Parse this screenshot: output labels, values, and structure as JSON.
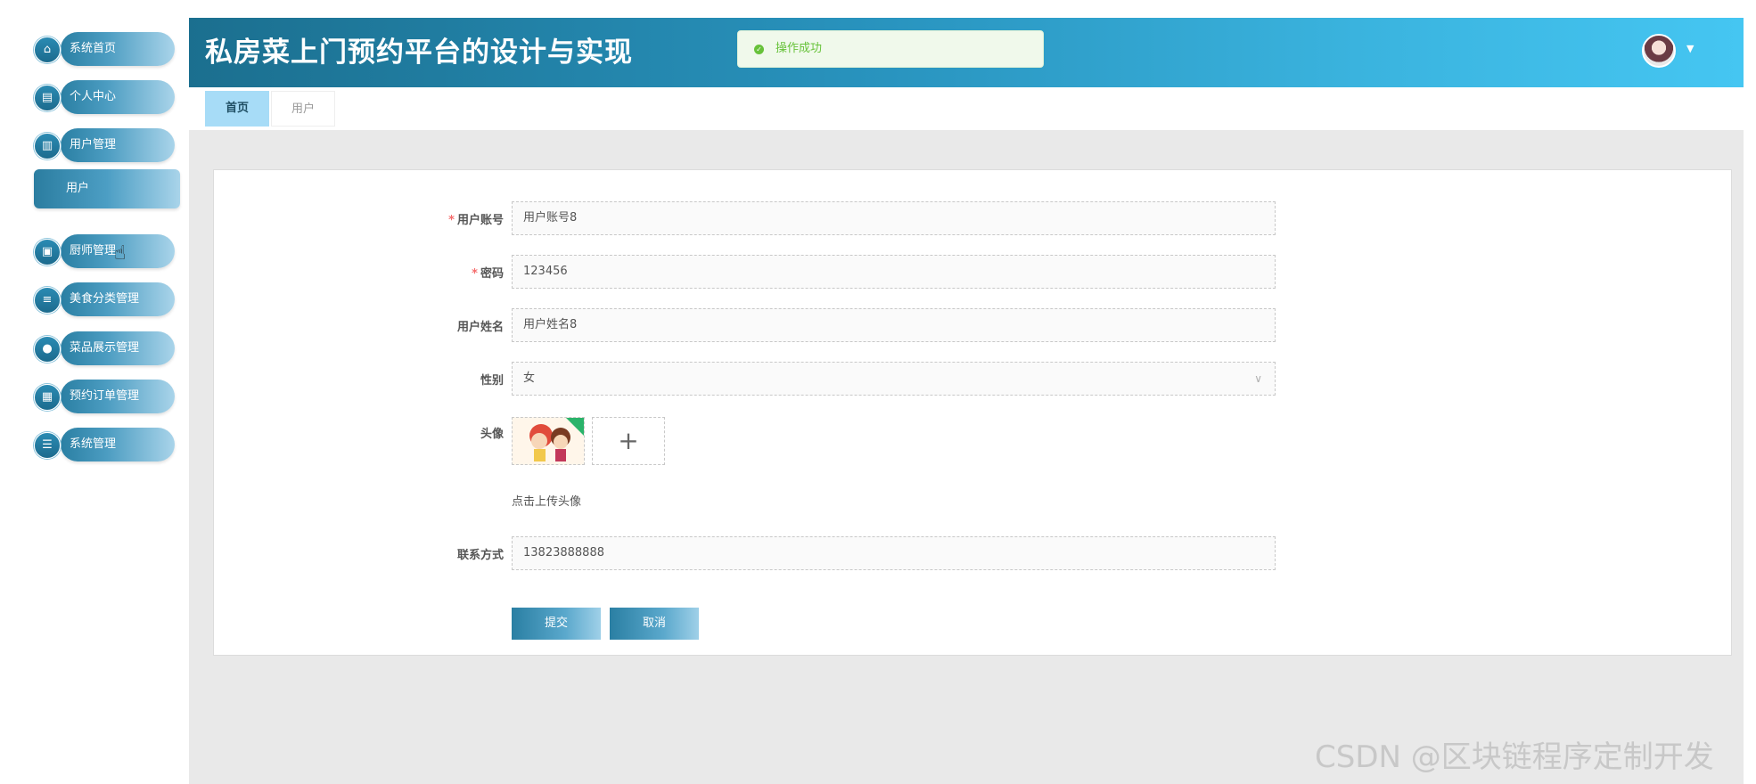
{
  "app": {
    "title": "私房菜上门预约平台的设计与实现"
  },
  "toast": {
    "text": "操作成功",
    "icon": "check-circle-icon",
    "color": "#67c23a"
  },
  "sidebar": {
    "items": [
      {
        "label": "系统首页",
        "icon": "home-icon",
        "glyph": "⌂"
      },
      {
        "label": "个人中心",
        "icon": "id-card-icon",
        "glyph": "▤"
      },
      {
        "label": "用户管理",
        "icon": "bar-chart-icon",
        "glyph": "▥"
      },
      {
        "label": "厨师管理",
        "icon": "clipboard-icon",
        "glyph": "▣"
      },
      {
        "label": "美食分类管理",
        "icon": "list-icon",
        "glyph": "≡"
      },
      {
        "label": "菜品展示管理",
        "icon": "bulb-icon",
        "glyph": "●"
      },
      {
        "label": "预约订单管理",
        "icon": "grid-icon",
        "glyph": "▦"
      },
      {
        "label": "系统管理",
        "icon": "sliders-icon",
        "glyph": "☰"
      }
    ],
    "submenu": {
      "label": "用户"
    }
  },
  "tabs": [
    {
      "label": "首页",
      "active": true
    },
    {
      "label": "用户",
      "active": false
    }
  ],
  "form": {
    "username": {
      "label": "用户账号",
      "required": true,
      "value": "用户账号8"
    },
    "password": {
      "label": "密码",
      "required": true,
      "value": "123456"
    },
    "realname": {
      "label": "用户姓名",
      "required": false,
      "value": "用户姓名8"
    },
    "gender": {
      "label": "性别",
      "required": false,
      "value": "女"
    },
    "avatar": {
      "label": "头像",
      "hint": "点击上传头像",
      "plus": "+"
    },
    "phone": {
      "label": "联系方式",
      "required": false,
      "value": "13823888888"
    },
    "submit_label": "提交",
    "cancel_label": "取消"
  },
  "watermark": "CSDN @区块链程序定制开发",
  "colors": {
    "accent": "#2a7fa3",
    "header_end": "#45c6f2",
    "active_tab": "#a7dcf7",
    "required": "#f56c6c"
  }
}
